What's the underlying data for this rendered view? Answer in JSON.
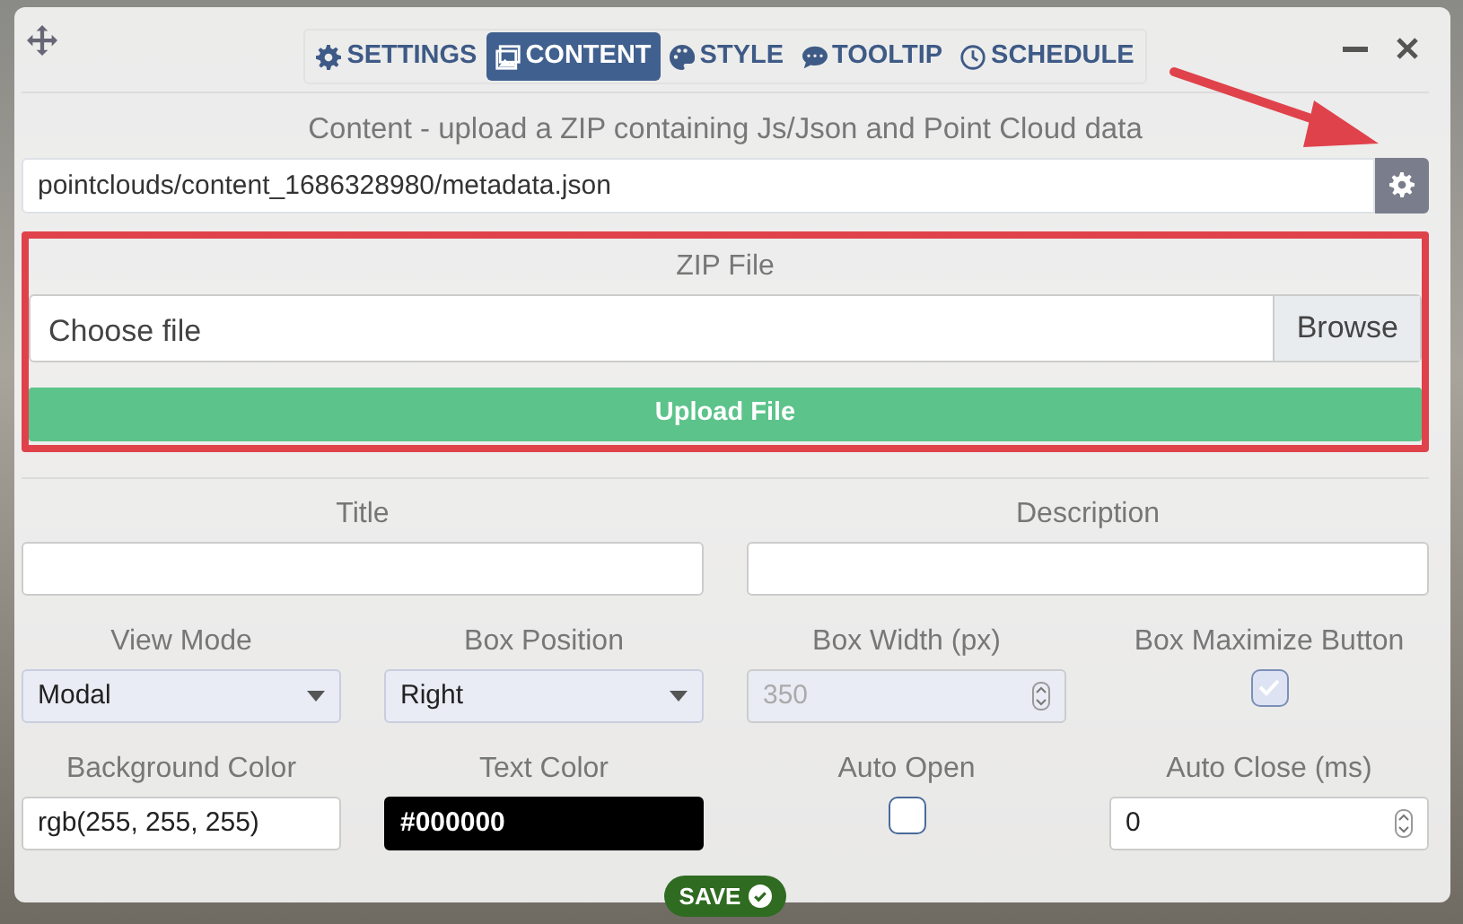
{
  "tabs": [
    {
      "label": "SETTINGS",
      "selected": false
    },
    {
      "label": "CONTENT",
      "selected": true
    },
    {
      "label": "STYLE",
      "selected": false
    },
    {
      "label": "TOOLTIP",
      "selected": false
    },
    {
      "label": "SCHEDULE",
      "selected": false
    }
  ],
  "content": {
    "caption": "Content - upload a ZIP containing Js/Json and Point Cloud data",
    "path": "pointclouds/content_1686328980/metadata.json"
  },
  "zip": {
    "label": "ZIP File",
    "file_placeholder": "Choose file",
    "browse": "Browse",
    "upload": "Upload File"
  },
  "rows": [
    [
      {
        "label": "Title",
        "kind": "text",
        "disabled": false
      },
      {
        "label": "Description",
        "kind": "text",
        "disabled": false
      }
    ],
    [
      {
        "label": "View Mode",
        "kind": "select",
        "value": "Modal",
        "disabled": false
      },
      {
        "label": "Box Position",
        "kind": "select",
        "value": "Right",
        "disabled": false
      },
      {
        "label": "Box Width (px)",
        "kind": "number",
        "value": "350",
        "disabled": true
      },
      {
        "label": "Box Maximize Button",
        "kind": "checkbox",
        "checked": true,
        "disabled": true
      }
    ],
    [
      {
        "label": "Background Color",
        "kind": "text",
        "value": "rgb(255, 255, 255)",
        "disabled": false
      },
      {
        "label": "Text Color",
        "kind": "color",
        "value": "#000000",
        "disabled": false
      },
      {
        "label": "Auto Open",
        "kind": "checkbox",
        "checked": false,
        "disabled": false
      },
      {
        "label": "Auto Close (ms)",
        "kind": "number",
        "value": "0",
        "disabled": false
      }
    ]
  ],
  "save": "SAVE"
}
